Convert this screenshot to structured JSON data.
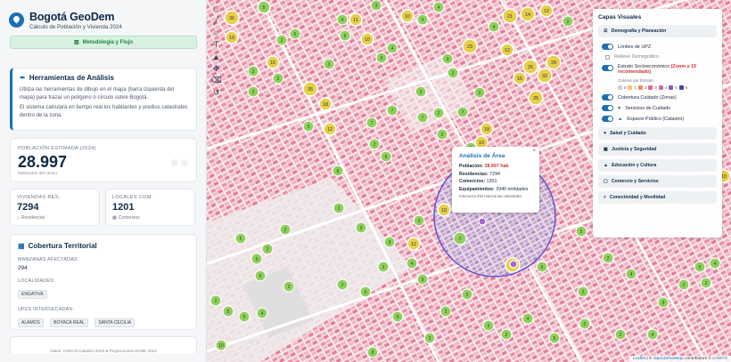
{
  "brand": {
    "title": "Bogotá GeoDem",
    "subtitle": "Cálculo de Población y Vivienda 2024"
  },
  "method_button": "Metodología y Flujo",
  "tools": {
    "title": "Herramientas de Análisis",
    "text1": "Utiliza las herramientas de dibujo en el mapa (barra izquierda del mapa) para trazar un polígono o círculo sobre Bogotá.",
    "text2": "El sistema calculará en tiempo real los habitantes y predios catastrales dentro de la zona."
  },
  "population": {
    "label": "POBLACIÓN ESTIMADA (2024)",
    "value": "28.997",
    "note": "habitantes del censo"
  },
  "housing": {
    "label": "VIVIENDAS RES.",
    "value": "7294",
    "foot": "Residencial"
  },
  "commercial": {
    "label": "LOCALES COM.",
    "value": "1201",
    "foot": "Comercios"
  },
  "territory": {
    "title": "Cobertura Territorial",
    "blocks_label": "MANZANAS AFECTADAS:",
    "blocks_value": "294",
    "localities_label": "LOCALIDADES:",
    "localities": [
      "ENGATIVA"
    ],
    "upz_label": "UPZS INTERSECADAS:",
    "upz": [
      "ALAMOS",
      "BOYACA REAL",
      "SANTA CECILIA"
    ]
  },
  "source": "Datos: UAECD Catastro 2023 & Proyecciones DANE 2024",
  "popup": {
    "title": "Análisis de Área",
    "close": "×",
    "pop_label": "Población:",
    "pop_value": "28.997 hab",
    "res_label": "Residencias:",
    "res_value": "7294",
    "com_label": "Comercios:",
    "com_value": "1201",
    "eq_label": "Equipamientos:",
    "eq_value": "2940 entidades",
    "note": "Intersecta 294 manzanas catastrales"
  },
  "layers": {
    "title": "Capas Visuales",
    "group1": "Demografía y Planeación",
    "upz_limits": "Límites de UPZ",
    "relief": "Relieve Demográfico",
    "strata": "Estrato Socioeconómico",
    "strata_note": "(Zoom ≥ 15 recomendado)",
    "colors_label": "Colores por Estrato:",
    "strata_levels": [
      "0",
      "1",
      "2",
      "3",
      "4",
      "5",
      "6"
    ],
    "strata_colors": [
      "#c9d3dd",
      "#f6c66d",
      "#ef8a62",
      "#e66a8a",
      "#c86ab0",
      "#8a5cb8",
      "#3d4a9a"
    ],
    "care_coverage": "Cobertura Cuidado (Zonas)",
    "care_services": "Servicios de Cuidado",
    "public_space": "Espacio Público (Catastro)",
    "groups": [
      "Salud y Cuidado",
      "Justicia y Seguridad",
      "Educación y Cultura",
      "Comercio y Servicios",
      "Conectividad y Movilidad"
    ]
  },
  "clusters": [
    {
      "label": "36",
      "color": "#e7cf4a"
    },
    {
      "label": "5",
      "color": "#8fcf5e"
    },
    {
      "label": "10",
      "color": "#e7cf4a"
    },
    {
      "label": "11",
      "color": "#e7cf4a"
    },
    {
      "label": "23",
      "color": "#e7cf4a"
    },
    {
      "label": "21",
      "color": "#e7cf4a"
    },
    {
      "label": "14",
      "color": "#e7cf4a"
    },
    {
      "label": "12",
      "color": "#e7cf4a"
    },
    {
      "label": "25",
      "color": "#e7cf4a"
    },
    {
      "label": "26",
      "color": "#e7cf4a"
    },
    {
      "label": "29",
      "color": "#e7cf4a"
    },
    {
      "label": "32",
      "color": "#e7cf4a"
    },
    {
      "label": "16",
      "color": "#e7cf4a"
    },
    {
      "label": "35",
      "color": "#e7cf4a"
    },
    {
      "label": "18",
      "color": "#e7cf4a"
    },
    {
      "label": "17",
      "color": "#e7cf4a"
    }
  ],
  "attribution": {
    "leaflet": "Leaflet",
    "osm": "OpenStreetMap",
    "rest": "contributors ©",
    "carto": "CARTO"
  }
}
